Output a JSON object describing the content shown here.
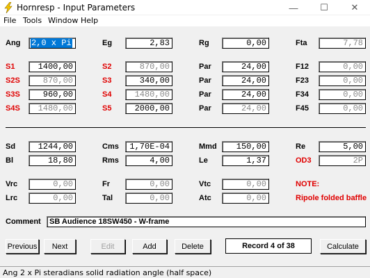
{
  "window": {
    "title": "Hornresp - Input Parameters",
    "minimize_glyph": "—",
    "maximize_glyph": "☐",
    "close_glyph": "✕"
  },
  "menu": [
    "File",
    "Tools",
    "Window",
    "Help"
  ],
  "params": {
    "ang": {
      "label": "Ang",
      "value": "2,0 x Pi"
    },
    "eg": {
      "label": "Eg",
      "value": "2,83"
    },
    "rg": {
      "label": "Rg",
      "value": "0,00"
    },
    "fta": {
      "label": "Fta",
      "value": "7,78"
    },
    "s1": {
      "label": "S1",
      "value": "1400,00"
    },
    "s2": {
      "label": "S2",
      "value": "870,00"
    },
    "par12": {
      "label": "Par",
      "value": "24,00"
    },
    "f12": {
      "label": "F12",
      "value": "0,00"
    },
    "s2s": {
      "label": "S2S",
      "value": "870,00"
    },
    "s3": {
      "label": "S3",
      "value": "340,00"
    },
    "par23": {
      "label": "Par",
      "value": "24,00"
    },
    "f23": {
      "label": "F23",
      "value": "0,00"
    },
    "s3s": {
      "label": "S3S",
      "value": "960,00"
    },
    "s4": {
      "label": "S4",
      "value": "1480,00"
    },
    "par34": {
      "label": "Par",
      "value": "24,00"
    },
    "f34": {
      "label": "F34",
      "value": "0,00"
    },
    "s4s": {
      "label": "S4S",
      "value": "1480,00"
    },
    "s5": {
      "label": "S5",
      "value": "2000,00"
    },
    "par45": {
      "label": "Par",
      "value": "24,00"
    },
    "f45": {
      "label": "F45",
      "value": "0,00"
    },
    "sd": {
      "label": "Sd",
      "value": "1244,00"
    },
    "cms": {
      "label": "Cms",
      "value": "1,70E-04"
    },
    "mmd": {
      "label": "Mmd",
      "value": "150,00"
    },
    "re": {
      "label": "Re",
      "value": "5,00"
    },
    "bl": {
      "label": "Bl",
      "value": "18,80"
    },
    "rms": {
      "label": "Rms",
      "value": "4,00"
    },
    "le": {
      "label": "Le",
      "value": "1,37"
    },
    "od3": {
      "label": "OD3",
      "value": "2P"
    },
    "vrc": {
      "label": "Vrc",
      "value": "0,00"
    },
    "fr": {
      "label": "Fr",
      "value": "0,00"
    },
    "vtc": {
      "label": "Vtc",
      "value": "0,00"
    },
    "lrc": {
      "label": "Lrc",
      "value": "0,00"
    },
    "tal": {
      "label": "Tal",
      "value": "0,00"
    },
    "atc": {
      "label": "Atc",
      "value": "0,00"
    }
  },
  "note": {
    "title": "NOTE:",
    "text": "Ripole folded baffle"
  },
  "comment": {
    "label": "Comment",
    "value": "SB Audience 18SW450 - W-frame"
  },
  "buttons": {
    "previous": "Previous",
    "next": "Next",
    "edit": "Edit",
    "add": "Add",
    "delete": "Delete",
    "calculate": "Calculate"
  },
  "record": "Record 4 of 38",
  "status": "Ang   2 x Pi steradians solid radiation angle  (half space)",
  "colors": {
    "label_red": "#e00000",
    "selection": "#0078d7",
    "disabled_text": "#8a8a8a"
  }
}
